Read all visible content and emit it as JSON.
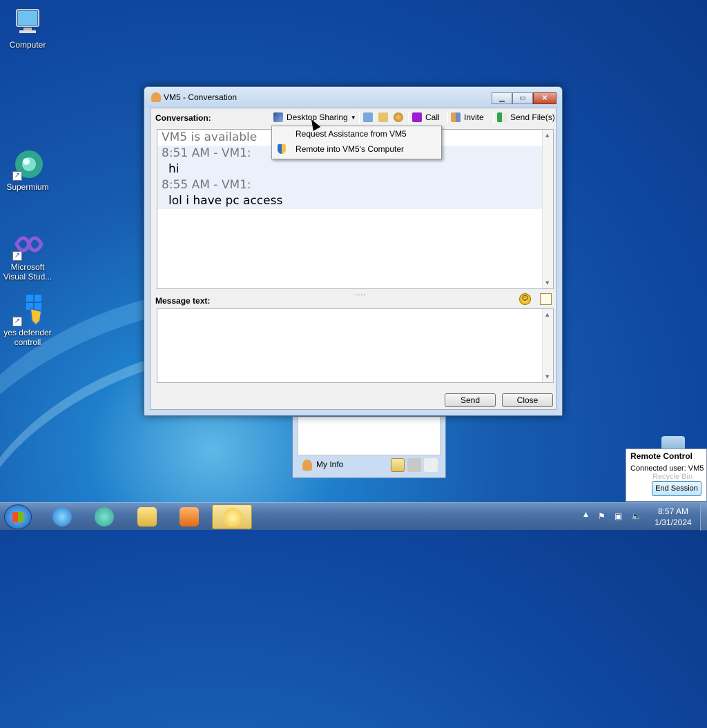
{
  "desktop": {
    "icons": [
      {
        "label": "Computer"
      },
      {
        "label": "Supermium"
      },
      {
        "label": "Microsoft Visual Stud..."
      },
      {
        "label": "yes defender controll"
      }
    ]
  },
  "window": {
    "title": "VM5 - Conversation",
    "conversation_label": "Conversation:",
    "toolbar": {
      "desktop_sharing": "Desktop Sharing",
      "call": "Call",
      "invite": "Invite",
      "send_files": "Send File(s)"
    },
    "chat": [
      {
        "kind": "status",
        "text": "VM5 is available"
      },
      {
        "kind": "hdr",
        "text": "8:51 AM - VM1:"
      },
      {
        "kind": "msg",
        "text": "hi"
      },
      {
        "kind": "hdr",
        "text": "8:55 AM - VM1:"
      },
      {
        "kind": "msg",
        "text": "lol i have pc access"
      }
    ],
    "message_text_label": "Message text:",
    "message_value": "",
    "send_label": "Send",
    "close_label": "Close",
    "splitter": "...."
  },
  "dropdown": {
    "items": [
      {
        "label": "Request Assistance from VM5",
        "icon": "none"
      },
      {
        "label": "Remote into VM5's Computer",
        "icon": "shield-icon"
      }
    ]
  },
  "messenger": {
    "my_info": "My Info"
  },
  "remote_control": {
    "title": "Remote Control",
    "connected": "Connected user: VM5",
    "end_session": "End Session",
    "recycle_bin_label": "Recycle Bin"
  },
  "taskbar": {
    "clock_time": "8:57 AM",
    "clock_date": "1/31/2024"
  }
}
